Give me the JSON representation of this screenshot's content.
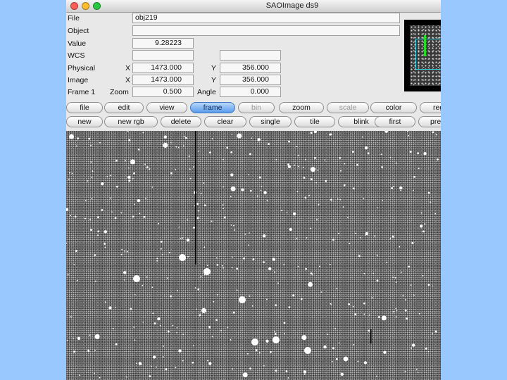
{
  "window": {
    "title": "SAOImage ds9",
    "lights": [
      "#ff5f57",
      "#ffbd2e",
      "#28c940"
    ]
  },
  "info": {
    "file_label": "File",
    "file_value": "obj219",
    "object_label": "Object",
    "object_value": "",
    "value_label": "Value",
    "value_value": "9.28223",
    "wcs_label": "WCS",
    "wcs_value1": "",
    "wcs_value2": "",
    "physical_label": "Physical",
    "physical_x_label": "X",
    "physical_x": "1473.000",
    "physical_y_label": "Y",
    "physical_y": "356.000",
    "image_label": "Image",
    "image_x_label": "X",
    "image_x": "1473.000",
    "image_y_label": "Y",
    "image_y": "356.000",
    "frame_label": "Frame 1",
    "zoom_label": "Zoom",
    "zoom_value": "0.500",
    "angle_label": "Angle",
    "angle_value": "0.000"
  },
  "menu_buttons": [
    {
      "label": "file",
      "state": "normal"
    },
    {
      "label": "edit",
      "state": "normal"
    },
    {
      "label": "view",
      "state": "normal"
    },
    {
      "label": "frame",
      "state": "active"
    },
    {
      "label": "bin",
      "state": "disabled"
    },
    {
      "label": "zoom",
      "state": "normal"
    },
    {
      "label": "scale",
      "state": "disabled"
    },
    {
      "label": "color",
      "state": "normal"
    },
    {
      "label": "reg",
      "state": "normal"
    }
  ],
  "action_buttons": [
    {
      "label": "new"
    },
    {
      "label": "new rgb"
    },
    {
      "label": "delete"
    },
    {
      "label": "clear"
    },
    {
      "label": "single"
    },
    {
      "label": "tile"
    },
    {
      "label": "blink"
    },
    {
      "label": "first"
    },
    {
      "label": "pre"
    }
  ],
  "colors": {
    "active_button": "#5a9bea",
    "panner_box": "#2fd0e0",
    "panner_marker": "#22dd22",
    "background": "#99c8ff"
  }
}
